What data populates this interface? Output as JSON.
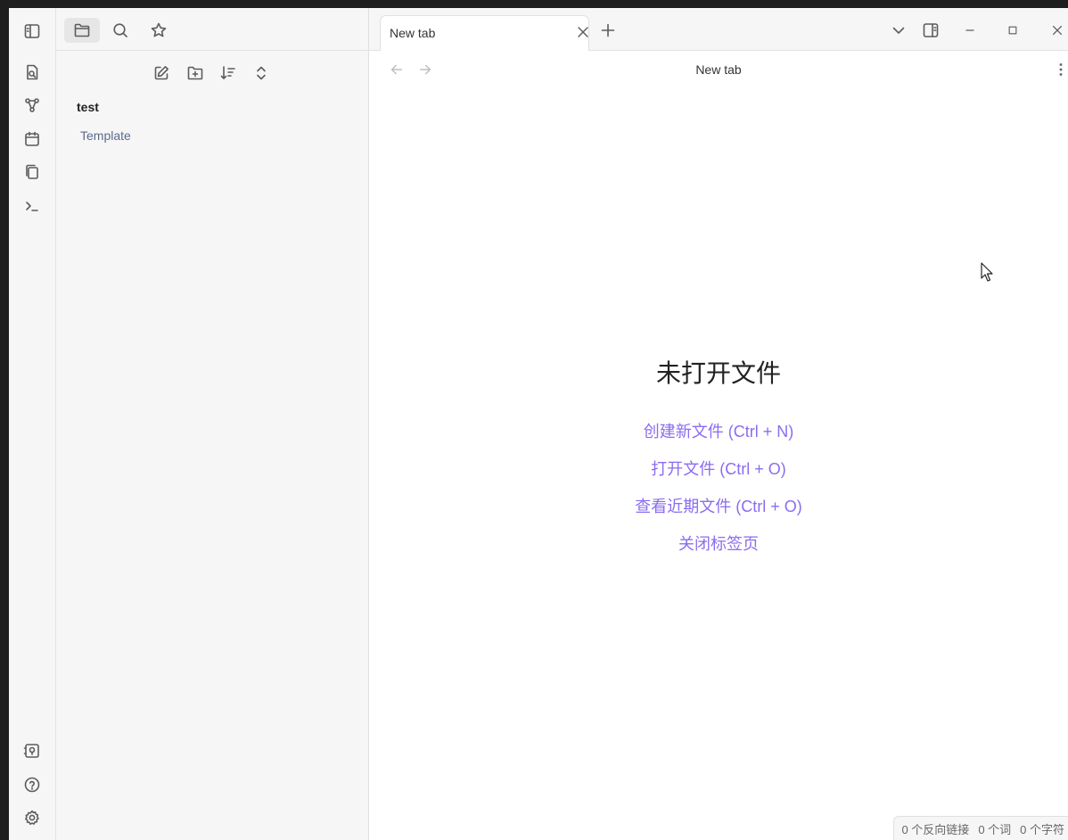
{
  "ribbon": {
    "icons": [
      "toggle-sidebar-icon",
      "open-quick-switcher-icon",
      "graph-view-icon",
      "daily-note-icon",
      "templates-icon",
      "command-palette-icon"
    ],
    "bottom_icons": [
      "vault-switcher-icon",
      "help-icon",
      "settings-icon"
    ]
  },
  "sidebar": {
    "tabs": [
      "files-icon",
      "search-icon",
      "bookmarks-icon"
    ],
    "toolbar": [
      "new-note-icon",
      "new-folder-icon",
      "sort-icon",
      "collapse-all-icon"
    ],
    "vault_name": "test",
    "items": [
      {
        "label": "Template"
      }
    ]
  },
  "tabs": [
    {
      "title": "New tab",
      "active": true
    }
  ],
  "view": {
    "title": "New tab",
    "empty_title": "未打开文件",
    "actions": [
      {
        "label": "创建新文件 (Ctrl + N)"
      },
      {
        "label": "打开文件 (Ctrl + O)"
      },
      {
        "label": "查看近期文件 (Ctrl + O)"
      },
      {
        "label": "关闭标签页"
      }
    ]
  },
  "statusbar": {
    "backlinks": "0 个反向链接",
    "words": "0 个词",
    "chars": "0 个字符"
  },
  "colors": {
    "accent": "#8b6cef",
    "link": "#5a6b8c"
  }
}
